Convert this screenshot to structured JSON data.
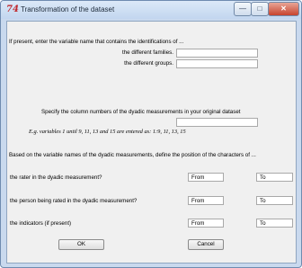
{
  "window": {
    "title": "Transformation of the dataset",
    "app_icon_text": "74",
    "controls": {
      "minimize": "—",
      "maximize": "□",
      "close": "✕"
    }
  },
  "section1": {
    "intro": "If present, enter the variable name that contains the identifications of ...",
    "families_label": "the different families.",
    "families_value": "",
    "groups_label": "the different groups.",
    "groups_value": ""
  },
  "section2": {
    "label": "Specify the column numbers of the dyadic measurements in your original dataset",
    "value": "",
    "example": "E.g. variables 1 until 9, 11, 13 and 15 are entered as: 1:9, 11, 13, 15"
  },
  "section3": {
    "intro": "Based on the variable names of the dyadic measurements, define the position of the characters of ...",
    "rows": [
      {
        "label": "the rater in the dyadic measurement?",
        "from": "From",
        "to": "To"
      },
      {
        "label": "the person being rated in the dyadic measurement?",
        "from": "From",
        "to": "To"
      },
      {
        "label": "the indicators (if present)",
        "from": "From",
        "to": "To"
      }
    ]
  },
  "buttons": {
    "ok": "OK",
    "cancel": "Cancel"
  }
}
